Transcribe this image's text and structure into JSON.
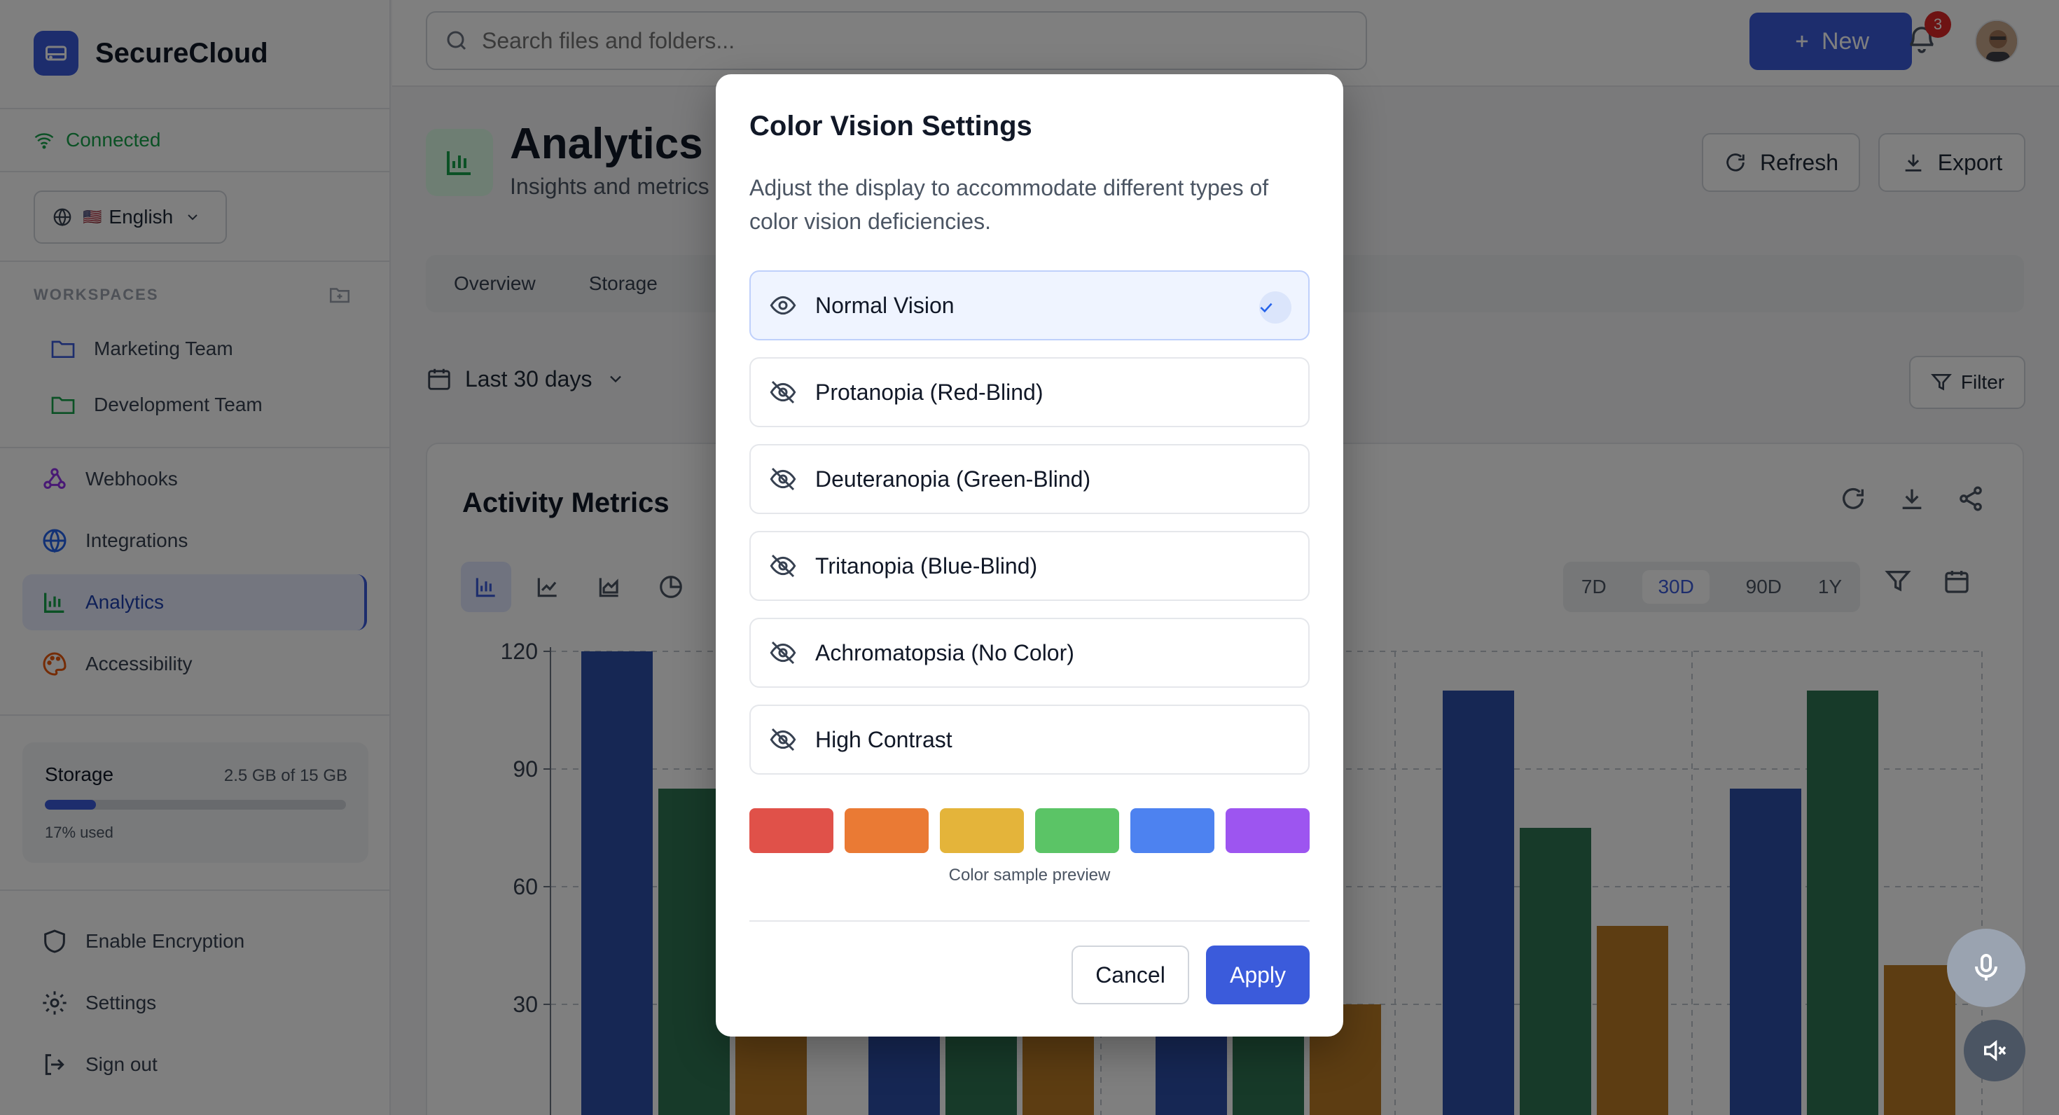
{
  "app": {
    "name": "SecureCloud"
  },
  "sidebar": {
    "status": "Connected",
    "language": {
      "flag": "🇺🇸",
      "label": "English"
    },
    "workspaces_heading": "WORKSPACES",
    "workspaces": [
      {
        "label": "Marketing Team"
      },
      {
        "label": "Development Team"
      }
    ],
    "nav": [
      {
        "label": "Webhooks",
        "icon": "webhook-icon"
      },
      {
        "label": "Integrations",
        "icon": "globe-icon"
      },
      {
        "label": "Analytics",
        "icon": "bar-chart-icon",
        "active": true
      },
      {
        "label": "Accessibility",
        "icon": "palette-icon"
      }
    ],
    "storage": {
      "label": "Storage",
      "value": "2.5 GB of 15 GB",
      "used": "17% used",
      "fraction": 0.17
    },
    "footer": [
      {
        "label": "Enable Encryption",
        "icon": "shield-icon"
      },
      {
        "label": "Settings",
        "icon": "gear-icon"
      },
      {
        "label": "Sign out",
        "icon": "sign-out-icon"
      }
    ]
  },
  "topbar": {
    "search_placeholder": "Search files and folders...",
    "new_label": "New",
    "notifications_count": "3"
  },
  "header": {
    "title": "Analytics D",
    "subtitle": "Insights and metrics",
    "refresh_label": "Refresh",
    "export_label": "Export"
  },
  "tabs": [
    {
      "label": "Overview"
    },
    {
      "label": "Storage"
    }
  ],
  "filters": {
    "range": "Last 30 days",
    "filter_label": "Filter"
  },
  "card": {
    "title": "Activity Metrics",
    "periods": [
      "7D",
      "30D",
      "90D",
      "1Y"
    ],
    "selected_period": "30D"
  },
  "chart_data": {
    "type": "bar",
    "yticks": [
      30,
      60,
      90,
      120
    ],
    "ylim": [
      0,
      120
    ],
    "colors": [
      "#2d4fa8",
      "#2f7552",
      "#bb7a24"
    ],
    "groups": [
      {
        "values": [
          120,
          85,
          40
        ]
      },
      {
        "values": [
          40,
          35,
          30
        ]
      },
      {
        "values": [
          40,
          30,
          30
        ]
      },
      {
        "values": [
          110,
          75,
          50
        ]
      },
      {
        "values": [
          85,
          110,
          40
        ]
      }
    ]
  },
  "modal": {
    "title": "Color Vision Settings",
    "description": "Adjust the display to accommodate different types of color vision deficiencies.",
    "options": [
      {
        "label": "Normal Vision",
        "selected": true
      },
      {
        "label": "Protanopia (Red-Blind)"
      },
      {
        "label": "Deuteranopia (Green-Blind)"
      },
      {
        "label": "Tritanopia (Blue-Blind)"
      },
      {
        "label": "Achromatopsia (No Color)"
      },
      {
        "label": "High Contrast"
      }
    ],
    "swatches": [
      "#e05149",
      "#ea7a34",
      "#e4b43a",
      "#5bc466",
      "#4d82f0",
      "#9d55f0"
    ],
    "swatch_caption": "Color sample preview",
    "cancel_label": "Cancel",
    "apply_label": "Apply"
  }
}
